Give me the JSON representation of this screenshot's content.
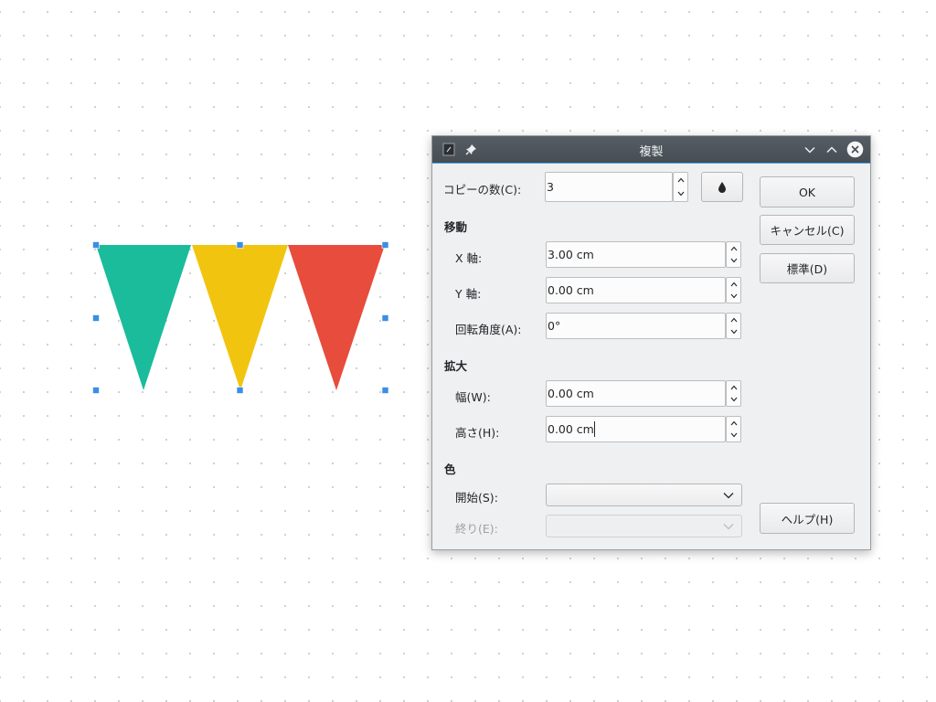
{
  "canvas": {
    "shapes": [
      {
        "name": "teal-triangle",
        "color": "#1abc9c"
      },
      {
        "name": "yellow-triangle",
        "color": "#f1c40f"
      },
      {
        "name": "red-triangle",
        "color": "#e74c3c"
      }
    ],
    "selection_color": "#3a8ee6"
  },
  "dialog": {
    "title": "複製",
    "copies": {
      "label": "コピーの数(C):",
      "value": "3"
    },
    "move": {
      "heading": "移動",
      "x": {
        "label": "X 軸:",
        "value": "3.00 cm"
      },
      "y": {
        "label": "Y 軸:",
        "value": "0.00 cm"
      },
      "angle": {
        "label": "回転角度(A):",
        "value": "0°"
      }
    },
    "enlarge": {
      "heading": "拡大",
      "width": {
        "label": "幅(W):",
        "value": "0.00 cm"
      },
      "height": {
        "label": "高さ(H):",
        "value": "0.00 cm"
      }
    },
    "colors": {
      "heading": "色",
      "start": {
        "label": "開始(S):",
        "value": ""
      },
      "end": {
        "label": "終り(E):",
        "value": ""
      }
    },
    "buttons": {
      "ok": "OK",
      "cancel": "キャンセル(C)",
      "defaults": "標準(D)",
      "help": "ヘルプ(H)"
    },
    "accent_color": "#3daee9"
  }
}
